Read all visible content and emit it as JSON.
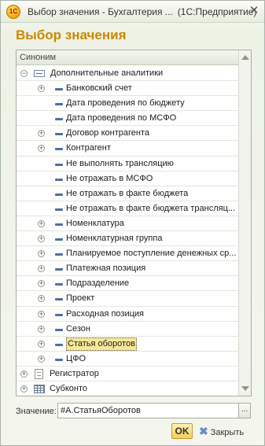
{
  "window": {
    "title_main": "Выбор значения - Бухгалтерия ...",
    "title_app": "(1С:Предприятие)",
    "app_logo_text": "1С"
  },
  "dialog": {
    "title": "Выбор значения"
  },
  "tree": {
    "column_header": "Синоним",
    "rows": [
      {
        "label": "Дополнительные аналитики",
        "level": 0,
        "expander": "minus",
        "icon": "folder-icon"
      },
      {
        "label": "Банковский счет",
        "level": 1,
        "expander": "plus",
        "icon": "attribute-icon"
      },
      {
        "label": "Дата проведения по бюджету",
        "level": 1,
        "expander": "",
        "icon": "attribute-icon"
      },
      {
        "label": "Дата проведения по МСФО",
        "level": 1,
        "expander": "",
        "icon": "attribute-icon"
      },
      {
        "label": "Договор контрагента",
        "level": 1,
        "expander": "plus",
        "icon": "attribute-icon"
      },
      {
        "label": "Контрагент",
        "level": 1,
        "expander": "plus",
        "icon": "attribute-icon"
      },
      {
        "label": "Не выполнять трансляцию",
        "level": 1,
        "expander": "",
        "icon": "attribute-icon"
      },
      {
        "label": "Не отражать в МСФО",
        "level": 1,
        "expander": "",
        "icon": "attribute-icon"
      },
      {
        "label": "Не отражать в факте бюджета",
        "level": 1,
        "expander": "",
        "icon": "attribute-icon"
      },
      {
        "label": "Не отражать в факте бюджета трансляц...",
        "level": 1,
        "expander": "",
        "icon": "attribute-icon"
      },
      {
        "label": "Номенклатура",
        "level": 1,
        "expander": "plus",
        "icon": "attribute-icon"
      },
      {
        "label": "Номенклатурная группа",
        "level": 1,
        "expander": "plus",
        "icon": "attribute-icon"
      },
      {
        "label": "Планируемое поступление денежных ср...",
        "level": 1,
        "expander": "plus",
        "icon": "attribute-icon"
      },
      {
        "label": "Платежная позиция",
        "level": 1,
        "expander": "plus",
        "icon": "attribute-icon"
      },
      {
        "label": "Подразделение",
        "level": 1,
        "expander": "plus",
        "icon": "attribute-icon"
      },
      {
        "label": "Проект",
        "level": 1,
        "expander": "plus",
        "icon": "attribute-icon"
      },
      {
        "label": "Расходная позиция",
        "level": 1,
        "expander": "plus",
        "icon": "attribute-icon"
      },
      {
        "label": "Сезон",
        "level": 1,
        "expander": "plus",
        "icon": "attribute-icon"
      },
      {
        "label": "Статья оборотов",
        "level": 1,
        "expander": "plus",
        "icon": "attribute-icon",
        "selected": true
      },
      {
        "label": "ЦФО",
        "level": 1,
        "expander": "plus",
        "icon": "attribute-icon"
      },
      {
        "label": "Регистратор",
        "level": 0,
        "expander": "plus",
        "icon": "document-icon"
      },
      {
        "label": "Субконто",
        "level": 0,
        "expander": "plus",
        "icon": "table-icon"
      }
    ]
  },
  "value": {
    "label": "Значение:",
    "text": "#А.СтатьяОборотов",
    "select_button": "..."
  },
  "buttons": {
    "ok": "OK",
    "close": "Закрыть",
    "close_icon": "✖"
  }
}
